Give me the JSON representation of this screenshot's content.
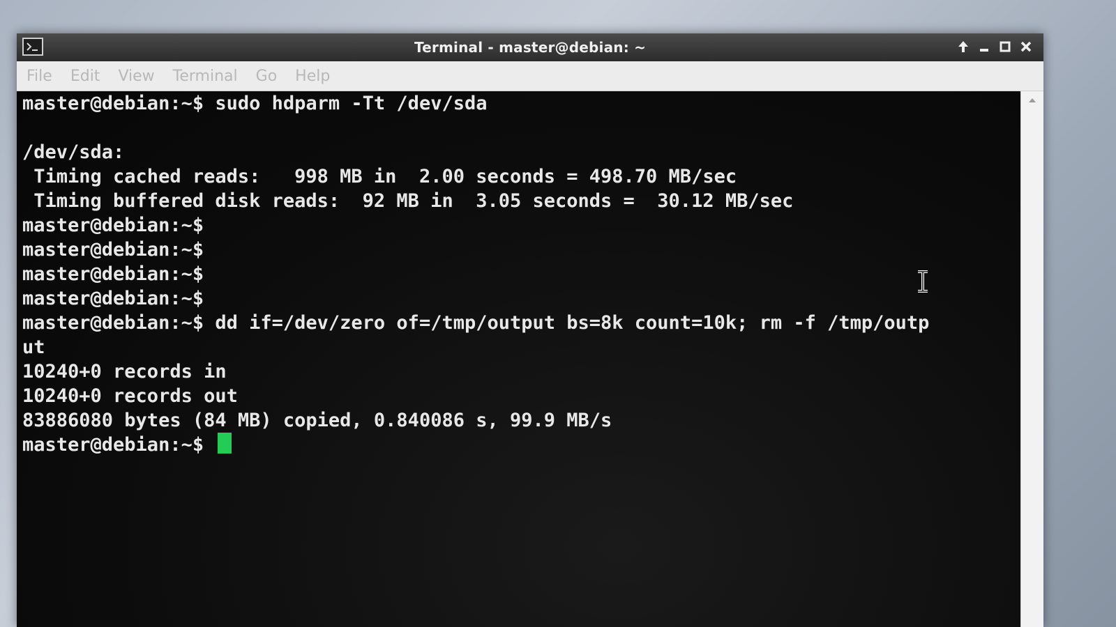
{
  "window": {
    "title": "Terminal - master@debian: ~"
  },
  "menu": {
    "items": [
      "File",
      "Edit",
      "View",
      "Terminal",
      "Go",
      "Help"
    ]
  },
  "terminal": {
    "lines": [
      "master@debian:~$ sudo hdparm -Tt /dev/sda",
      "",
      "/dev/sda:",
      " Timing cached reads:   998 MB in  2.00 seconds = 498.70 MB/sec",
      " Timing buffered disk reads:  92 MB in  3.05 seconds =  30.12 MB/sec",
      "master@debian:~$",
      "master@debian:~$",
      "master@debian:~$",
      "master@debian:~$",
      "master@debian:~$ dd if=/dev/zero of=/tmp/output bs=8k count=10k; rm -f /tmp/outp",
      "ut",
      "10240+0 records in",
      "10240+0 records out",
      "83886080 bytes (84 MB) copied, 0.840086 s, 99.9 MB/s"
    ],
    "prompt": "master@debian:~$ ",
    "cursor_color": "#22cc55"
  },
  "icons": {
    "app": "terminal-icon",
    "controls": [
      "up-arrow-icon",
      "minimize-icon",
      "maximize-icon",
      "close-icon"
    ],
    "mouse": "text-cursor-icon"
  }
}
